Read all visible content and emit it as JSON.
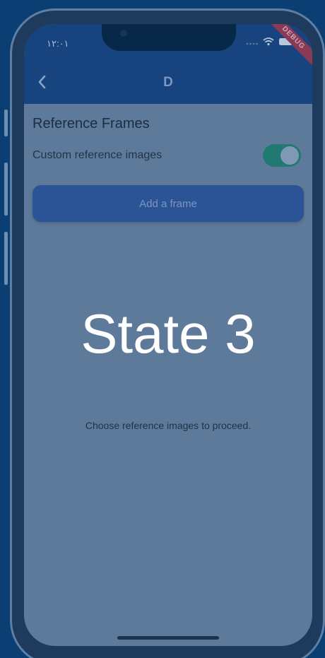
{
  "status_bar": {
    "time": "۱۲:۰۱",
    "debug_banner": "DEBUG",
    "icons": [
      "signal-dots-icon",
      "wifi-icon",
      "battery-icon"
    ]
  },
  "app_bar": {
    "title": "D",
    "back_icon": "chevron-left-icon"
  },
  "content": {
    "section_title": "Reference Frames",
    "toggle_label": "Custom reference images",
    "toggle_on": true,
    "add_frame_label": "Add a frame",
    "hint": "Choose reference images to proceed."
  },
  "overlay": {
    "state_label": "State 3"
  },
  "colors": {
    "background": "#0b3f74",
    "app_bar": "#17437f",
    "screen": "#5e7a9a",
    "toggle_track": "#217a72",
    "button": "#2b5496"
  }
}
